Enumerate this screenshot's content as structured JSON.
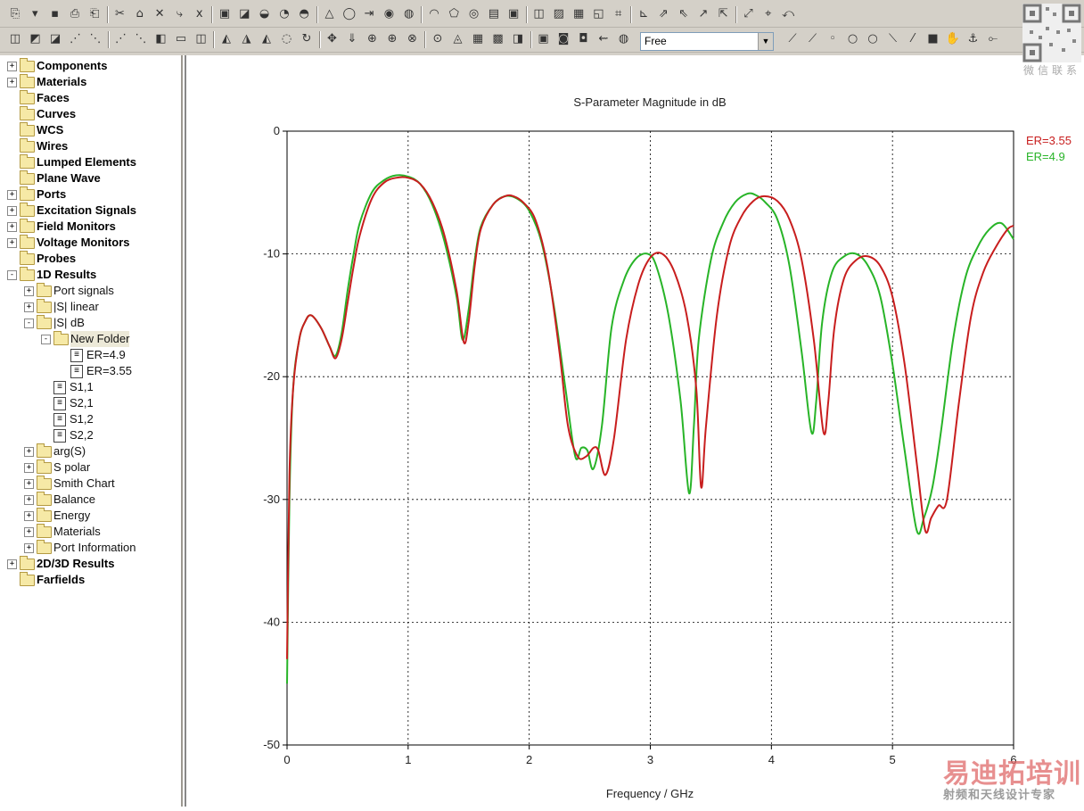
{
  "toolbar": {
    "combo_value": "Free"
  },
  "tree": {
    "items": [
      {
        "label": "Components",
        "level": 0,
        "bold": true,
        "expander": "+"
      },
      {
        "label": "Materials",
        "level": 0,
        "bold": true,
        "expander": "+"
      },
      {
        "label": "Faces",
        "level": 0,
        "bold": true,
        "expander": ""
      },
      {
        "label": "Curves",
        "level": 0,
        "bold": true,
        "expander": ""
      },
      {
        "label": "WCS",
        "level": 0,
        "bold": true,
        "expander": ""
      },
      {
        "label": "Wires",
        "level": 0,
        "bold": true,
        "expander": ""
      },
      {
        "label": "Lumped Elements",
        "level": 0,
        "bold": true,
        "expander": ""
      },
      {
        "label": "Plane Wave",
        "level": 0,
        "bold": true,
        "expander": ""
      },
      {
        "label": "Ports",
        "level": 0,
        "bold": true,
        "expander": "+"
      },
      {
        "label": "Excitation Signals",
        "level": 0,
        "bold": true,
        "expander": "+"
      },
      {
        "label": "Field Monitors",
        "level": 0,
        "bold": true,
        "expander": "+"
      },
      {
        "label": "Voltage Monitors",
        "level": 0,
        "bold": true,
        "expander": "+"
      },
      {
        "label": "Probes",
        "level": 0,
        "bold": true,
        "expander": ""
      },
      {
        "label": "1D Results",
        "level": 0,
        "bold": true,
        "expander": "-"
      },
      {
        "label": "Port signals",
        "level": 1,
        "bold": false,
        "expander": "+"
      },
      {
        "label": "|S| linear",
        "level": 1,
        "bold": false,
        "expander": "+"
      },
      {
        "label": "|S| dB",
        "level": 1,
        "bold": false,
        "expander": "-"
      },
      {
        "label": "New Folder",
        "level": 2,
        "bold": false,
        "expander": "-",
        "selected": true
      },
      {
        "label": "ER=4.9",
        "level": 3,
        "bold": false,
        "expander": "",
        "doc": true
      },
      {
        "label": "ER=3.55",
        "level": 3,
        "bold": false,
        "expander": "",
        "doc": true
      },
      {
        "label": "S1,1",
        "level": 2,
        "bold": false,
        "expander": "",
        "doc": true
      },
      {
        "label": "S2,1",
        "level": 2,
        "bold": false,
        "expander": "",
        "doc": true
      },
      {
        "label": "S1,2",
        "level": 2,
        "bold": false,
        "expander": "",
        "doc": true
      },
      {
        "label": "S2,2",
        "level": 2,
        "bold": false,
        "expander": "",
        "doc": true
      },
      {
        "label": "arg(S)",
        "level": 1,
        "bold": false,
        "expander": "+"
      },
      {
        "label": "S polar",
        "level": 1,
        "bold": false,
        "expander": "+"
      },
      {
        "label": "Smith Chart",
        "level": 1,
        "bold": false,
        "expander": "+"
      },
      {
        "label": "Balance",
        "level": 1,
        "bold": false,
        "expander": "+"
      },
      {
        "label": "Energy",
        "level": 1,
        "bold": false,
        "expander": "+"
      },
      {
        "label": "Materials",
        "level": 1,
        "bold": false,
        "expander": "+"
      },
      {
        "label": "Port Information",
        "level": 1,
        "bold": false,
        "expander": "+"
      },
      {
        "label": "2D/3D Results",
        "level": 0,
        "bold": true,
        "expander": "+"
      },
      {
        "label": "Farfields",
        "level": 0,
        "bold": true,
        "expander": ""
      }
    ]
  },
  "watermark": {
    "qr_caption": "微信联系",
    "brand": "易迪拓培训",
    "brand_sub": "射频和天线设计专家"
  },
  "chart_data": {
    "type": "line",
    "title": "S-Parameter Magnitude in dB",
    "xlabel": "Frequency / GHz",
    "ylabel": "",
    "xlim": [
      0,
      6
    ],
    "ylim": [
      -50,
      0
    ],
    "xticks": [
      "0",
      "1",
      "2",
      "3",
      "4",
      "5",
      "6"
    ],
    "yticks": [
      "0",
      "-10",
      "-20",
      "-30",
      "-40",
      "-50"
    ],
    "grid": true,
    "legend_placement": "top-right",
    "series": [
      {
        "name": "ER=3.55",
        "color": "#c81e1e",
        "x": [
          0.0,
          0.02,
          0.05,
          0.1,
          0.15,
          0.2,
          0.28,
          0.35,
          0.4,
          0.45,
          0.5,
          0.55,
          0.6,
          0.7,
          0.8,
          0.9,
          1.0,
          1.1,
          1.2,
          1.3,
          1.4,
          1.46,
          1.5,
          1.55,
          1.6,
          1.7,
          1.8,
          1.87,
          1.95,
          2.05,
          2.15,
          2.25,
          2.32,
          2.4,
          2.47,
          2.53,
          2.57,
          2.63,
          2.7,
          2.8,
          2.9,
          3.0,
          3.1,
          3.2,
          3.3,
          3.38,
          3.42,
          3.46,
          3.55,
          3.65,
          3.75,
          3.85,
          3.94,
          4.05,
          4.15,
          4.25,
          4.35,
          4.43,
          4.47,
          4.52,
          4.6,
          4.7,
          4.8,
          4.9,
          5.0,
          5.1,
          5.2,
          5.27,
          5.32,
          5.38,
          5.45,
          5.55,
          5.65,
          5.75,
          5.85,
          5.95,
          6.0
        ],
        "y": [
          -43,
          -28,
          -21,
          -17,
          -15.5,
          -15,
          -16,
          -17.5,
          -18.5,
          -17,
          -14,
          -11,
          -8.5,
          -5.5,
          -4.2,
          -3.8,
          -3.8,
          -4.3,
          -5.8,
          -8.5,
          -13,
          -17.2,
          -15.5,
          -11,
          -8,
          -6,
          -5.3,
          -5.3,
          -5.8,
          -7.2,
          -11,
          -18,
          -24,
          -26.5,
          -26.5,
          -25.8,
          -26,
          -28,
          -25,
          -17,
          -12.5,
          -10.3,
          -10,
          -11.5,
          -15,
          -21,
          -29,
          -24,
          -15,
          -9.5,
          -7,
          -5.7,
          -5.3,
          -5.7,
          -7.2,
          -10.5,
          -17,
          -24.5,
          -22,
          -16,
          -12,
          -10.5,
          -10.2,
          -11,
          -13.5,
          -19,
          -27,
          -32.5,
          -31.5,
          -30.5,
          -30,
          -22,
          -15,
          -11.5,
          -9.5,
          -8,
          -7.7
        ]
      },
      {
        "name": "ER=4.9",
        "color": "#28b428",
        "x": [
          0.0,
          0.02,
          0.05,
          0.1,
          0.15,
          0.2,
          0.28,
          0.35,
          0.4,
          0.45,
          0.5,
          0.55,
          0.6,
          0.7,
          0.8,
          0.9,
          1.0,
          1.1,
          1.2,
          1.3,
          1.4,
          1.45,
          1.5,
          1.55,
          1.6,
          1.7,
          1.8,
          1.9,
          2.0,
          2.1,
          2.2,
          2.3,
          2.38,
          2.43,
          2.48,
          2.53,
          2.6,
          2.68,
          2.78,
          2.88,
          2.98,
          3.05,
          3.15,
          3.25,
          3.32,
          3.36,
          3.4,
          3.5,
          3.6,
          3.7,
          3.8,
          3.87,
          3.95,
          4.05,
          4.15,
          4.25,
          4.33,
          4.37,
          4.42,
          4.5,
          4.6,
          4.7,
          4.8,
          4.9,
          5.0,
          5.1,
          5.2,
          5.26,
          5.33,
          5.4,
          5.5,
          5.6,
          5.7,
          5.8,
          5.9,
          6.0
        ],
        "y": [
          -45,
          -30,
          -21,
          -17,
          -15.5,
          -15,
          -16,
          -17.5,
          -18.3,
          -16.5,
          -13,
          -10,
          -7.5,
          -5,
          -4,
          -3.6,
          -3.7,
          -4.3,
          -6,
          -9,
          -13.5,
          -17,
          -14.5,
          -10.5,
          -7.8,
          -6,
          -5.3,
          -5.5,
          -6.5,
          -9,
          -14,
          -21,
          -26.5,
          -25.8,
          -26,
          -27.5,
          -24,
          -16,
          -12.2,
          -10.4,
          -10,
          -11,
          -15,
          -22,
          -29.5,
          -24,
          -17,
          -10.5,
          -7.5,
          -5.8,
          -5.1,
          -5.2,
          -5.8,
          -7.2,
          -11,
          -18,
          -24.5,
          -22,
          -15.5,
          -11.5,
          -10.2,
          -10,
          -11,
          -13.5,
          -19,
          -26,
          -32.5,
          -31.5,
          -29,
          -24.5,
          -17,
          -12,
          -9.5,
          -8,
          -7.5,
          -8.8
        ]
      }
    ]
  }
}
